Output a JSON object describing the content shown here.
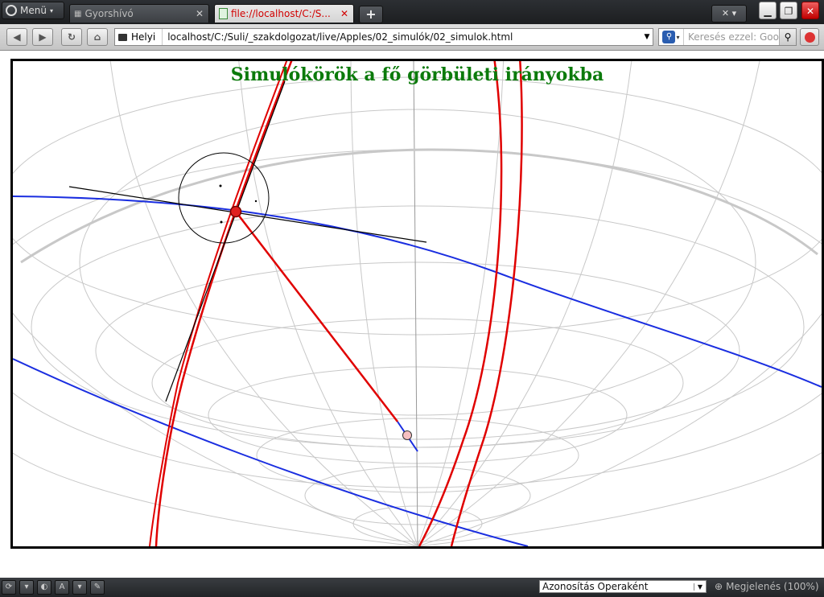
{
  "browser": {
    "menu_label": "Menü",
    "tabs": [
      {
        "label": "Gyorshívó",
        "close": "✕"
      },
      {
        "label": "file://localhost/C:/S...",
        "close": "✕"
      }
    ],
    "new_tab": "+",
    "closed_tabs": "✕ ▾",
    "window_buttons": {
      "minimize": "▁",
      "restore": "❐",
      "close": "✕"
    }
  },
  "toolbar": {
    "site_label": "Helyi",
    "url": "localhost/C:/Suli/_szakdolgozat/live/Apples/02_simulók/02_simulok.html",
    "search_placeholder": "Keresés ezzel: Goo",
    "search_engine_glyph": "🔍",
    "back": "◀",
    "forward": "▶",
    "reload": "↻",
    "home": "⌂"
  },
  "applet": {
    "title": "Simulókörök a fő görbületi irányokba"
  },
  "statusbar": {
    "text_size_label": "A",
    "ident_label": "Azonosítás Operaként",
    "zoom_label": "Megjelenés (100%)"
  },
  "colors": {
    "accent_red": "#e00000",
    "curve_blue": "#1a2ee0",
    "title_green": "#0b7a0b",
    "grid_gray": "#c8c8c8"
  }
}
